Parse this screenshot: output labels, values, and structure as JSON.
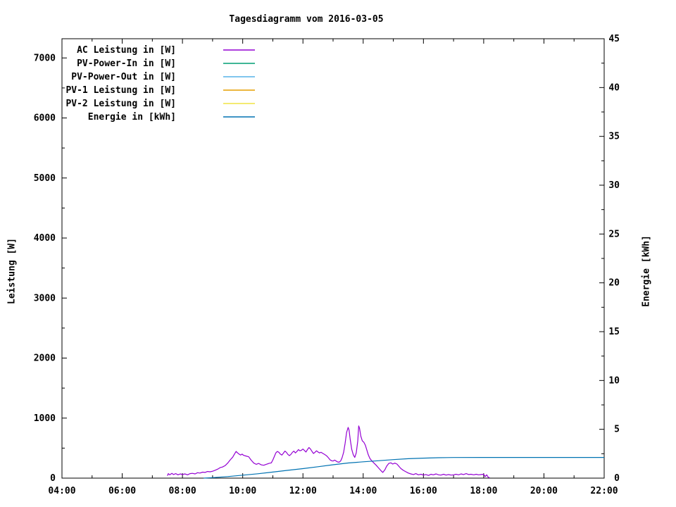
{
  "window": {
    "background": "#ffffff"
  },
  "chart_data": {
    "type": "line",
    "title": "Tagesdiagramm vom 2016-03-05",
    "xlabel": "",
    "y1": {
      "label": "Leistung [W]",
      "range": [
        0,
        7320
      ],
      "major_step": 1000,
      "minor_step": 500,
      "label_max": 7000
    },
    "y2": {
      "label": "Energie [kWh]",
      "range": [
        0,
        45
      ],
      "major_step": 5,
      "minor_step": 2.5
    },
    "x_range_hours": [
      4,
      22
    ],
    "x_major_step_hours": 2,
    "x_minor_step_hours": 1,
    "grid": false,
    "legend_position": "top-left-inside",
    "x_tick_labels": [
      {
        "h": 4,
        "label": "04:00"
      },
      {
        "h": 6,
        "label": "06:00"
      },
      {
        "h": 8,
        "label": "08:00"
      },
      {
        "h": 10,
        "label": "10:00"
      },
      {
        "h": 12,
        "label": "12:00"
      },
      {
        "h": 14,
        "label": "14:00"
      },
      {
        "h": 16,
        "label": "16:00"
      },
      {
        "h": 18,
        "label": "18:00"
      },
      {
        "h": 20,
        "label": "20:00"
      },
      {
        "h": 22,
        "label": "22:00"
      }
    ],
    "series": [
      {
        "name": "AC Leistung in [W]",
        "color": "#9400d3",
        "axis": "y1",
        "points": [
          [
            7.5,
            40
          ],
          [
            7.53,
            75
          ],
          [
            7.58,
            55
          ],
          [
            7.65,
            80
          ],
          [
            7.7,
            60
          ],
          [
            7.78,
            75
          ],
          [
            7.85,
            55
          ],
          [
            7.93,
            70
          ],
          [
            8.0,
            60
          ],
          [
            8.08,
            70
          ],
          [
            8.17,
            55
          ],
          [
            8.25,
            75
          ],
          [
            8.33,
            80
          ],
          [
            8.42,
            70
          ],
          [
            8.5,
            90
          ],
          [
            8.58,
            85
          ],
          [
            8.67,
            100
          ],
          [
            8.75,
            95
          ],
          [
            8.83,
            110
          ],
          [
            8.92,
            105
          ],
          [
            9.0,
            115
          ],
          [
            9.08,
            130
          ],
          [
            9.17,
            150
          ],
          [
            9.25,
            175
          ],
          [
            9.33,
            185
          ],
          [
            9.42,
            210
          ],
          [
            9.5,
            250
          ],
          [
            9.58,
            300
          ],
          [
            9.67,
            350
          ],
          [
            9.72,
            395
          ],
          [
            9.78,
            445
          ],
          [
            9.83,
            420
          ],
          [
            9.88,
            400
          ],
          [
            9.93,
            385
          ],
          [
            9.98,
            400
          ],
          [
            10.03,
            380
          ],
          [
            10.1,
            370
          ],
          [
            10.2,
            355
          ],
          [
            10.28,
            300
          ],
          [
            10.37,
            250
          ],
          [
            10.45,
            230
          ],
          [
            10.53,
            245
          ],
          [
            10.62,
            220
          ],
          [
            10.7,
            215
          ],
          [
            10.78,
            230
          ],
          [
            10.87,
            245
          ],
          [
            10.95,
            255
          ],
          [
            11.0,
            300
          ],
          [
            11.05,
            360
          ],
          [
            11.1,
            420
          ],
          [
            11.15,
            445
          ],
          [
            11.2,
            430
          ],
          [
            11.25,
            400
          ],
          [
            11.3,
            385
          ],
          [
            11.35,
            415
          ],
          [
            11.4,
            450
          ],
          [
            11.45,
            430
          ],
          [
            11.5,
            395
          ],
          [
            11.55,
            375
          ],
          [
            11.6,
            395
          ],
          [
            11.65,
            430
          ],
          [
            11.7,
            450
          ],
          [
            11.75,
            420
          ],
          [
            11.8,
            445
          ],
          [
            11.85,
            475
          ],
          [
            11.9,
            455
          ],
          [
            11.95,
            465
          ],
          [
            12.0,
            485
          ],
          [
            12.05,
            460
          ],
          [
            12.1,
            435
          ],
          [
            12.15,
            475
          ],
          [
            12.2,
            510
          ],
          [
            12.25,
            485
          ],
          [
            12.3,
            445
          ],
          [
            12.35,
            410
          ],
          [
            12.4,
            430
          ],
          [
            12.45,
            455
          ],
          [
            12.5,
            435
          ],
          [
            12.55,
            420
          ],
          [
            12.6,
            430
          ],
          [
            12.65,
            415
          ],
          [
            12.7,
            400
          ],
          [
            12.75,
            385
          ],
          [
            12.8,
            365
          ],
          [
            12.85,
            335
          ],
          [
            12.9,
            305
          ],
          [
            12.95,
            290
          ],
          [
            13.0,
            285
          ],
          [
            13.05,
            300
          ],
          [
            13.1,
            285
          ],
          [
            13.15,
            270
          ],
          [
            13.2,
            265
          ],
          [
            13.25,
            285
          ],
          [
            13.3,
            340
          ],
          [
            13.35,
            430
          ],
          [
            13.4,
            580
          ],
          [
            13.45,
            760
          ],
          [
            13.5,
            845
          ],
          [
            13.53,
            800
          ],
          [
            13.57,
            640
          ],
          [
            13.62,
            480
          ],
          [
            13.67,
            390
          ],
          [
            13.72,
            345
          ],
          [
            13.77,
            420
          ],
          [
            13.82,
            620
          ],
          [
            13.85,
            870
          ],
          [
            13.88,
            830
          ],
          [
            13.92,
            700
          ],
          [
            13.97,
            620
          ],
          [
            14.02,
            600
          ],
          [
            14.07,
            550
          ],
          [
            14.12,
            470
          ],
          [
            14.17,
            390
          ],
          [
            14.22,
            330
          ],
          [
            14.28,
            290
          ],
          [
            14.35,
            255
          ],
          [
            14.43,
            215
          ],
          [
            14.5,
            175
          ],
          [
            14.58,
            130
          ],
          [
            14.65,
            95
          ],
          [
            14.72,
            140
          ],
          [
            14.78,
            200
          ],
          [
            14.85,
            245
          ],
          [
            14.92,
            255
          ],
          [
            14.98,
            235
          ],
          [
            15.05,
            250
          ],
          [
            15.12,
            235
          ],
          [
            15.18,
            200
          ],
          [
            15.25,
            160
          ],
          [
            15.33,
            130
          ],
          [
            15.42,
            105
          ],
          [
            15.5,
            85
          ],
          [
            15.58,
            70
          ],
          [
            15.67,
            60
          ],
          [
            15.75,
            75
          ],
          [
            15.83,
            55
          ],
          [
            15.92,
            65
          ],
          [
            16.0,
            50
          ],
          [
            16.08,
            60
          ],
          [
            16.17,
            45
          ],
          [
            16.25,
            65
          ],
          [
            16.33,
            55
          ],
          [
            16.42,
            70
          ],
          [
            16.5,
            55
          ],
          [
            16.58,
            50
          ],
          [
            16.67,
            65
          ],
          [
            16.75,
            50
          ],
          [
            16.83,
            60
          ],
          [
            16.92,
            50
          ],
          [
            17.0,
            55
          ],
          [
            17.08,
            65
          ],
          [
            17.17,
            55
          ],
          [
            17.25,
            70
          ],
          [
            17.33,
            60
          ],
          [
            17.42,
            75
          ],
          [
            17.5,
            60
          ],
          [
            17.58,
            65
          ],
          [
            17.67,
            55
          ],
          [
            17.75,
            65
          ],
          [
            17.83,
            55
          ],
          [
            17.92,
            60
          ],
          [
            18.0,
            65
          ],
          [
            18.05,
            25
          ],
          [
            18.1,
            55
          ],
          [
            18.15,
            15
          ],
          [
            18.2,
            5
          ]
        ]
      },
      {
        "name": "PV-Power-In in [W]",
        "color": "#009e73",
        "axis": "y1",
        "points": []
      },
      {
        "name": "PV-Power-Out in [W]",
        "color": "#56b4e9",
        "axis": "y1",
        "points": []
      },
      {
        "name": "PV-1 Leistung in [W]",
        "color": "#e69f00",
        "axis": "y1",
        "points": []
      },
      {
        "name": "PV-2 Leistung in [W]",
        "color": "#f0e442",
        "axis": "y1",
        "points": []
      },
      {
        "name": "Energie in [kWh]",
        "color": "#0072b2",
        "axis": "y2",
        "points": [
          [
            8.7,
            0.0
          ],
          [
            9.0,
            0.05
          ],
          [
            9.5,
            0.16
          ],
          [
            10.0,
            0.3
          ],
          [
            10.5,
            0.45
          ],
          [
            11.0,
            0.62
          ],
          [
            11.5,
            0.8
          ],
          [
            12.0,
            0.97
          ],
          [
            12.5,
            1.17
          ],
          [
            13.0,
            1.37
          ],
          [
            13.5,
            1.55
          ],
          [
            14.0,
            1.67
          ],
          [
            14.5,
            1.78
          ],
          [
            15.0,
            1.9
          ],
          [
            15.5,
            1.99
          ],
          [
            16.0,
            2.05
          ],
          [
            16.5,
            2.09
          ],
          [
            17.0,
            2.11
          ],
          [
            18.0,
            2.12
          ],
          [
            19.0,
            2.12
          ],
          [
            20.0,
            2.12
          ],
          [
            21.0,
            2.12
          ],
          [
            22.0,
            2.12
          ]
        ]
      }
    ]
  }
}
